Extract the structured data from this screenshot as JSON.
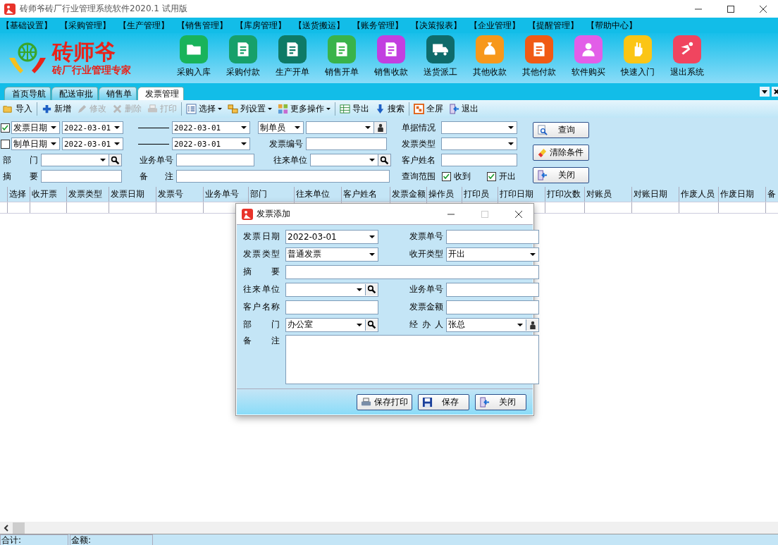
{
  "window": {
    "title": "砖师爷砖厂行业管理系统软件2020.1 试用版"
  },
  "menu": [
    "【基础设置】",
    "【采购管理】",
    "【生产管理】",
    "【销售管理】",
    "【库房管理】",
    "【送货搬运】",
    "【账务管理】",
    "【决策报表】",
    "【企业管理】",
    "【提醒管理】",
    "【帮助中心】"
  ],
  "brand": {
    "name": "砖师爷",
    "slogan": "砖厂行业管理专家"
  },
  "quick_actions": [
    {
      "label": "采购入库",
      "color": "#19b35a",
      "kind": "folder"
    },
    {
      "label": "采购付款",
      "color": "#17a06a",
      "kind": "document"
    },
    {
      "label": "生产开单",
      "color": "#0e7a66",
      "kind": "document"
    },
    {
      "label": "销售开单",
      "color": "#39b34a",
      "kind": "document"
    },
    {
      "label": "销售收款",
      "color": "#c23fe0",
      "kind": "document"
    },
    {
      "label": "送货派工",
      "color": "#0f6b6b",
      "kind": "truck"
    },
    {
      "label": "其他收款",
      "color": "#f7981b",
      "kind": "bag"
    },
    {
      "label": "其他付款",
      "color": "#f05a14",
      "kind": "document"
    },
    {
      "label": "软件购买",
      "color": "#e25ee8",
      "kind": "people"
    },
    {
      "label": "快速入门",
      "color": "#fbc515",
      "kind": "hand"
    },
    {
      "label": "退出系统",
      "color": "#f0455f",
      "kind": "runner"
    }
  ],
  "tabs": [
    {
      "label": "首页导航",
      "selected": false
    },
    {
      "label": "配送审批",
      "selected": false
    },
    {
      "label": "销售单",
      "selected": false
    },
    {
      "label": "发票管理",
      "selected": true
    }
  ],
  "toolbar": [
    [
      {
        "label": "导入",
        "kind": "folder",
        "disabled": false,
        "menu": false
      }
    ],
    [
      {
        "label": "新增",
        "kind": "plus",
        "disabled": false,
        "menu": false
      },
      {
        "label": "修改",
        "kind": "pencil",
        "disabled": true,
        "menu": false
      },
      {
        "label": "删除",
        "kind": "cross",
        "disabled": true,
        "menu": false
      },
      {
        "label": "打印",
        "kind": "printer",
        "disabled": true,
        "menu": false
      }
    ],
    [
      {
        "label": "选择",
        "kind": "list",
        "disabled": false,
        "menu": true
      },
      {
        "label": "列设置",
        "kind": "columns",
        "disabled": false,
        "menu": true
      },
      {
        "label": "更多操作",
        "kind": "grid",
        "disabled": false,
        "menu": true
      }
    ],
    [
      {
        "label": "导出",
        "kind": "sheet",
        "disabled": false,
        "menu": false
      },
      {
        "label": "搜索",
        "kind": "down",
        "disabled": false,
        "menu": false
      }
    ],
    [
      {
        "label": "全屏",
        "kind": "checker",
        "disabled": false,
        "menu": false
      },
      {
        "label": "退出",
        "kind": "door",
        "disabled": false,
        "menu": false
      }
    ]
  ],
  "filter": {
    "date_ranges": [
      {
        "checked": true,
        "field": "发票日期",
        "from": "2022-03-01",
        "to": "2022-03-01"
      },
      {
        "checked": false,
        "field": "制单日期",
        "from": "2022-03-01",
        "to": "2022-03-01"
      }
    ],
    "maker_field": "制单员",
    "invoice_no_label": "发票编号",
    "dept_label": "部 门",
    "business_no_label": "业务单号",
    "partner_label": "往来单位",
    "summary_label": "摘 要",
    "remark_label": "备 注",
    "status_label": "单据情况",
    "type_label": "发票类型",
    "customer_label": "客户姓名",
    "scope_label": "查询范围",
    "scope_options": [
      {
        "label": "收到",
        "checked": true
      },
      {
        "label": "开出",
        "checked": true
      }
    ],
    "buttons": [
      {
        "label": "查询",
        "kind": "search"
      },
      {
        "label": "清除条件",
        "kind": "eraser"
      },
      {
        "label": "关闭",
        "kind": "door"
      }
    ]
  },
  "table": {
    "columns": [
      "选择",
      "收开票",
      "发票类型",
      "发票日期",
      "发票号",
      "业务单号",
      "部门",
      "往来单位",
      "客户姓名",
      "发票金额",
      "操作员",
      "打印员",
      "打印日期",
      "打印次数",
      "对账员",
      "对账日期",
      "作废人员",
      "作废日期",
      "备"
    ]
  },
  "dialog": {
    "title": "发票添加",
    "fields": [
      {
        "label": "发票日期",
        "kind": "dropdown",
        "value": "2022-03-01"
      },
      {
        "label": "发票单号",
        "kind": "text"
      },
      {
        "label": "发票类型",
        "kind": "dropdown",
        "value": "普通发票"
      },
      {
        "label": "收开类型",
        "kind": "dropdown",
        "value": "开出"
      },
      {
        "label": "摘 要",
        "kind": "wide"
      },
      {
        "label": "往来单位",
        "kind": "search-combo"
      },
      {
        "label": "业务单号",
        "kind": "text"
      },
      {
        "label": "客户名称",
        "kind": "text"
      },
      {
        "label": "发票金额",
        "kind": "text"
      },
      {
        "label": "部 门",
        "kind": "search-combo",
        "value": "办公室"
      },
      {
        "label": "经 办 人",
        "kind": "person-combo",
        "value": "张总"
      },
      {
        "label": "备 注",
        "kind": "memo"
      }
    ],
    "buttons": [
      {
        "label": "保存打印",
        "kind": "printer"
      },
      {
        "label": "保存",
        "kind": "floppy"
      },
      {
        "label": "关闭",
        "kind": "door"
      }
    ]
  },
  "status_bar": [
    "合计:",
    "金额:"
  ]
}
